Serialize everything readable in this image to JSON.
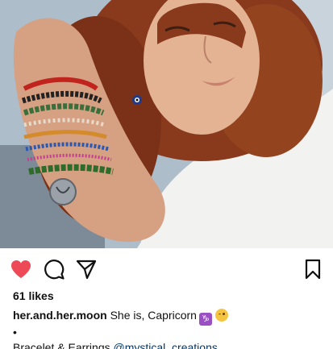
{
  "post": {
    "likes_text": "61 likes",
    "username": "her.and.her.moon",
    "caption_text": "She is, Capricorn",
    "caption_emojis": [
      "capricorn-sign",
      "smirking-face"
    ],
    "caption_separator": "•",
    "credit_text": "Bracelet & Earrings",
    "credit_mention": "@mystical_creations__"
  },
  "actions": {
    "like": "heart-icon",
    "comment": "comment-bubble-icon",
    "share": "paper-plane-icon",
    "save": "bookmark-icon"
  },
  "colors": {
    "like_active": "#ed4956",
    "mention": "#00376b",
    "text": "#111111"
  }
}
